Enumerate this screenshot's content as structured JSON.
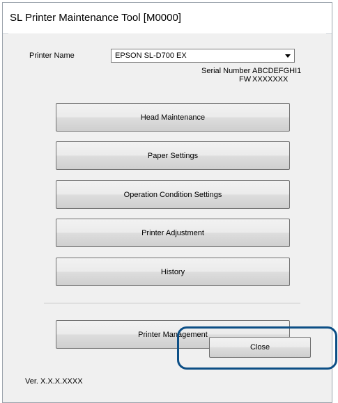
{
  "window": {
    "title": "SL Printer Maintenance Tool [M0000]"
  },
  "printer": {
    "name_label": "Printer Name",
    "selected": "EPSON SL-D700 EX",
    "serial_label": "Serial Number",
    "serial_value": "ABCDEFGHI1",
    "fw_label": "FW",
    "fw_value": "XXXXXXX"
  },
  "buttons": {
    "head_maintenance": "Head Maintenance",
    "paper_settings": "Paper Settings",
    "operation_condition_settings": "Operation Condition Settings",
    "printer_adjustment": "Printer Adjustment",
    "history": "History",
    "printer_management": "Printer Management",
    "close": "Close"
  },
  "footer": {
    "version": "Ver. X.X.X.XXXX"
  },
  "colors": {
    "highlight_border": "#0d4f86",
    "dialog_background": "#f0f0f0"
  }
}
